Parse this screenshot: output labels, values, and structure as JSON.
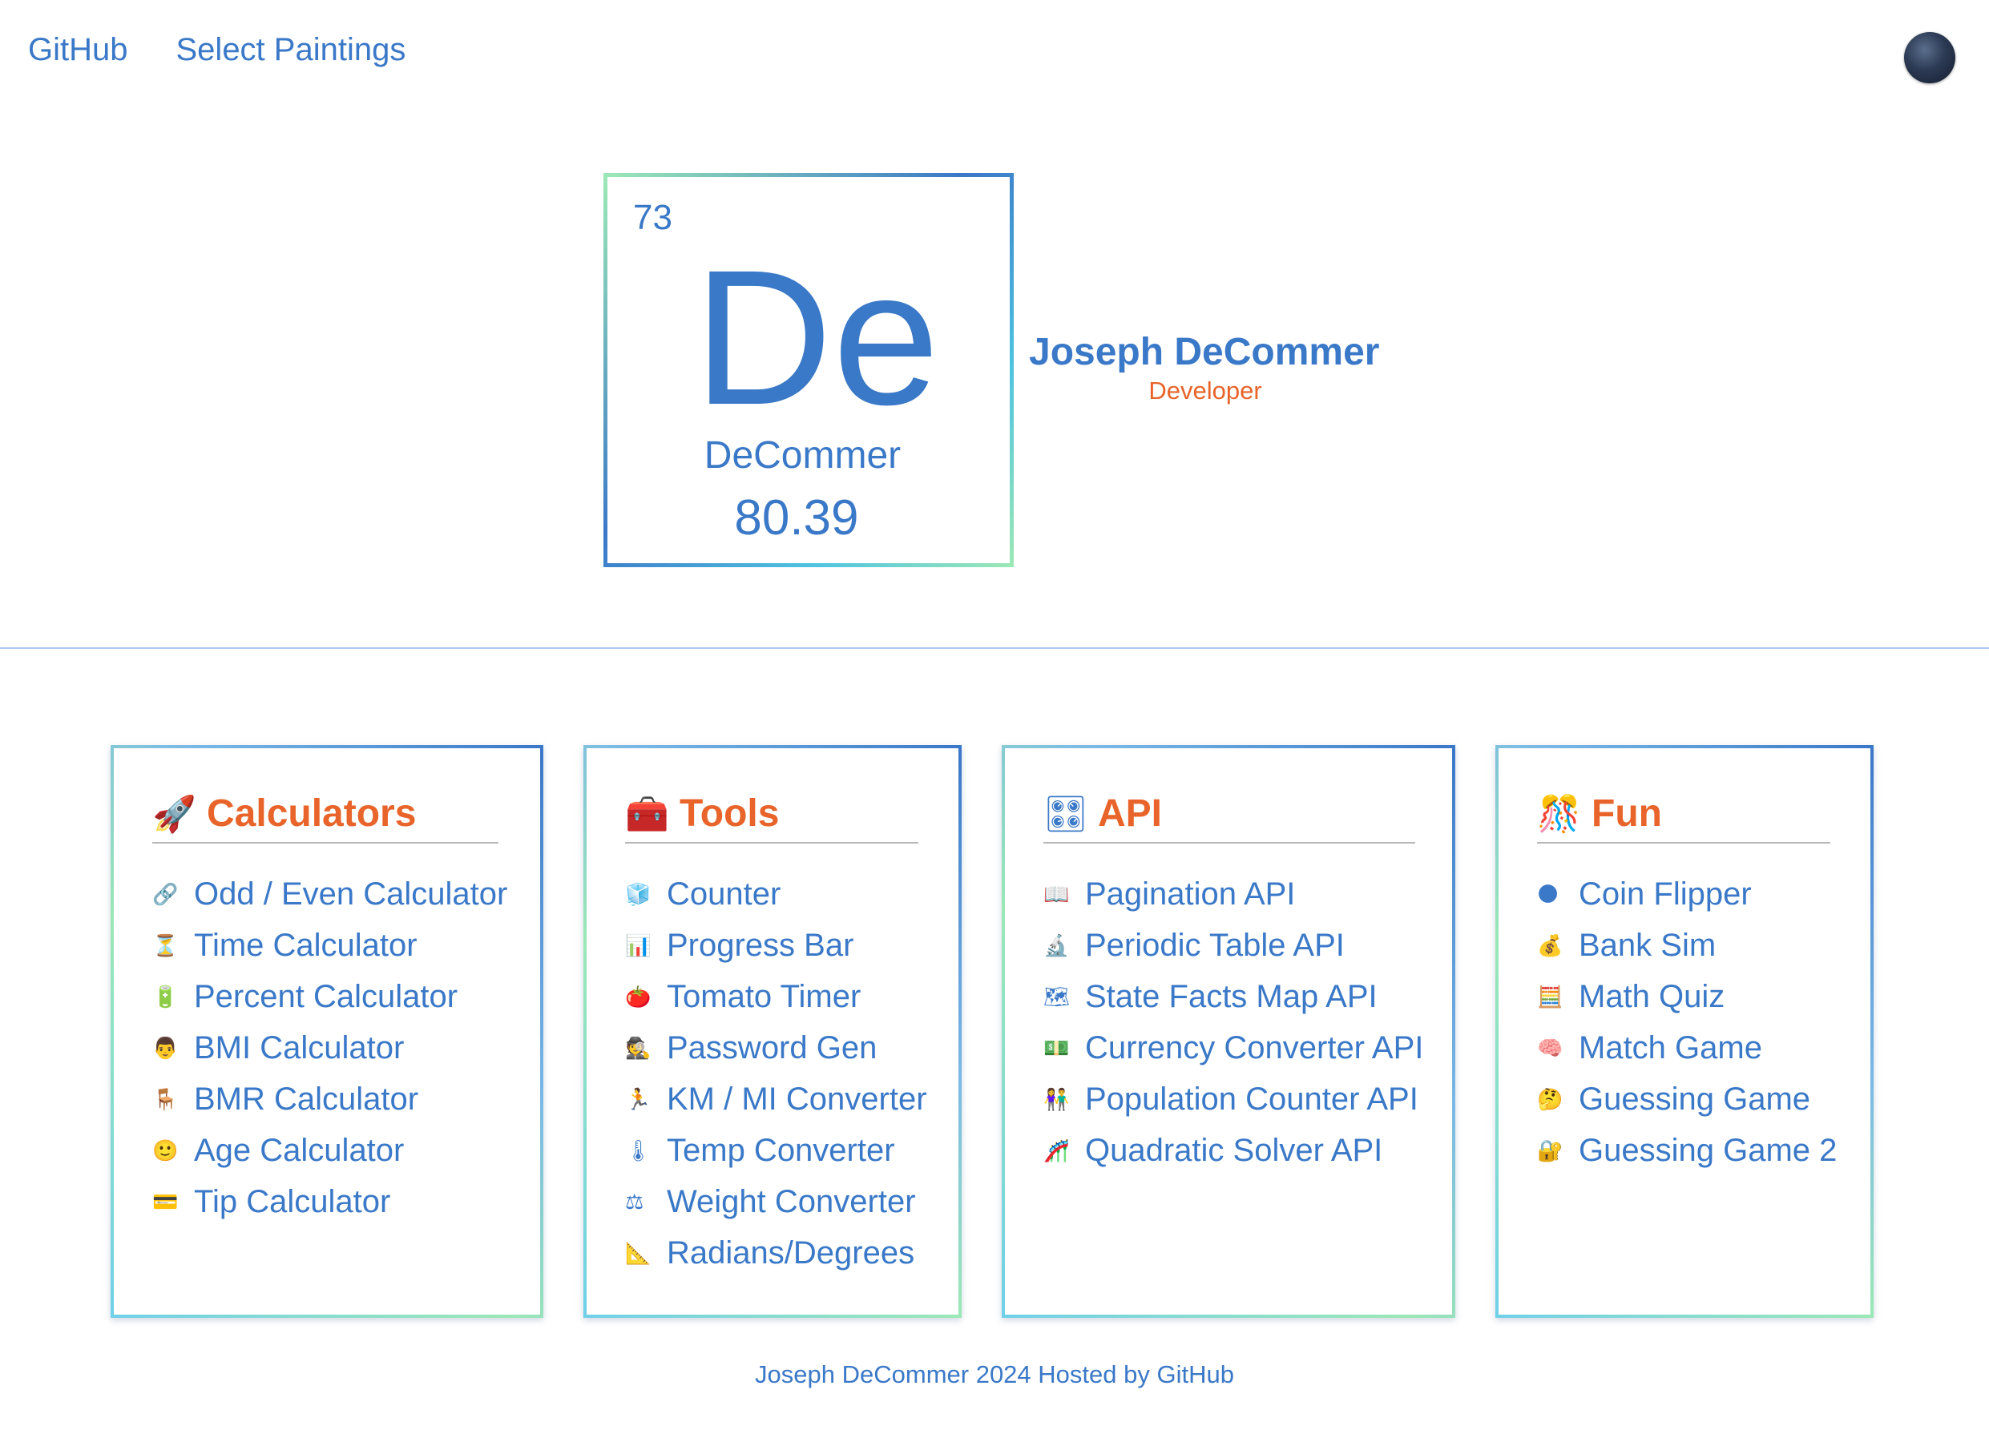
{
  "nav": {
    "links": [
      "GitHub",
      "Select Paintings"
    ]
  },
  "theme_toggle": {
    "icon": "moon-globe-icon"
  },
  "element": {
    "number": "73",
    "symbol": "De",
    "name": "DeCommer",
    "mass": "80.39"
  },
  "profile": {
    "name": "Joseph DeCommer",
    "role": "Developer"
  },
  "colors": {
    "link_blue": "#3a78c8",
    "accent_orange": "#e8642a",
    "gradient_green": "#9be8b6"
  },
  "cards": [
    {
      "title": "Calculators",
      "emoji": "🚀",
      "items": [
        {
          "icon": "🔗",
          "label": "Odd / Even Calculator"
        },
        {
          "icon": "⏳",
          "label": "Time Calculator"
        },
        {
          "icon": "🔋",
          "label": "Percent Calculator"
        },
        {
          "icon": "👨",
          "label": "BMI Calculator"
        },
        {
          "icon": "🪑",
          "label": "BMR Calculator"
        },
        {
          "icon": "🙂",
          "label": "Age Calculator"
        },
        {
          "icon": "💳",
          "label": "Tip Calculator"
        }
      ]
    },
    {
      "title": "Tools",
      "emoji": "🧰",
      "items": [
        {
          "icon": "🧊",
          "label": "Counter"
        },
        {
          "icon": "📊",
          "label": "Progress Bar"
        },
        {
          "icon": "🍅",
          "label": "Tomato Timer"
        },
        {
          "icon": "🕵",
          "label": "Password Gen"
        },
        {
          "icon": "🏃",
          "label": "KM / MI Converter"
        },
        {
          "icon": "🌡",
          "label": "Temp Converter"
        },
        {
          "icon": "⚖",
          "label": "Weight Converter"
        },
        {
          "icon": "📐",
          "label": "Radians/Degrees"
        }
      ]
    },
    {
      "title": "API",
      "emoji": "🎛",
      "items": [
        {
          "icon": "📖",
          "label": "Pagination API"
        },
        {
          "icon": "🔬",
          "label": "Periodic Table API"
        },
        {
          "icon": "🗺",
          "label": "State Facts Map API"
        },
        {
          "icon": "💵",
          "label": "Currency Converter API"
        },
        {
          "icon": "👫",
          "label": "Population Counter API"
        },
        {
          "icon": "🎢",
          "label": "Quadratic Solver API"
        }
      ]
    },
    {
      "title": "Fun",
      "emoji": "🎊",
      "items": [
        {
          "icon": "🌑",
          "label": "Coin Flipper"
        },
        {
          "icon": "💰",
          "label": "Bank Sim"
        },
        {
          "icon": "🧮",
          "label": "Math Quiz"
        },
        {
          "icon": "🧠",
          "label": "Match Game"
        },
        {
          "icon": "🤔",
          "label": "Guessing Game"
        },
        {
          "icon": "🔐",
          "label": "Guessing Game 2"
        }
      ]
    }
  ],
  "footer": {
    "text": "Joseph DeCommer 2024 Hosted by GitHub"
  }
}
